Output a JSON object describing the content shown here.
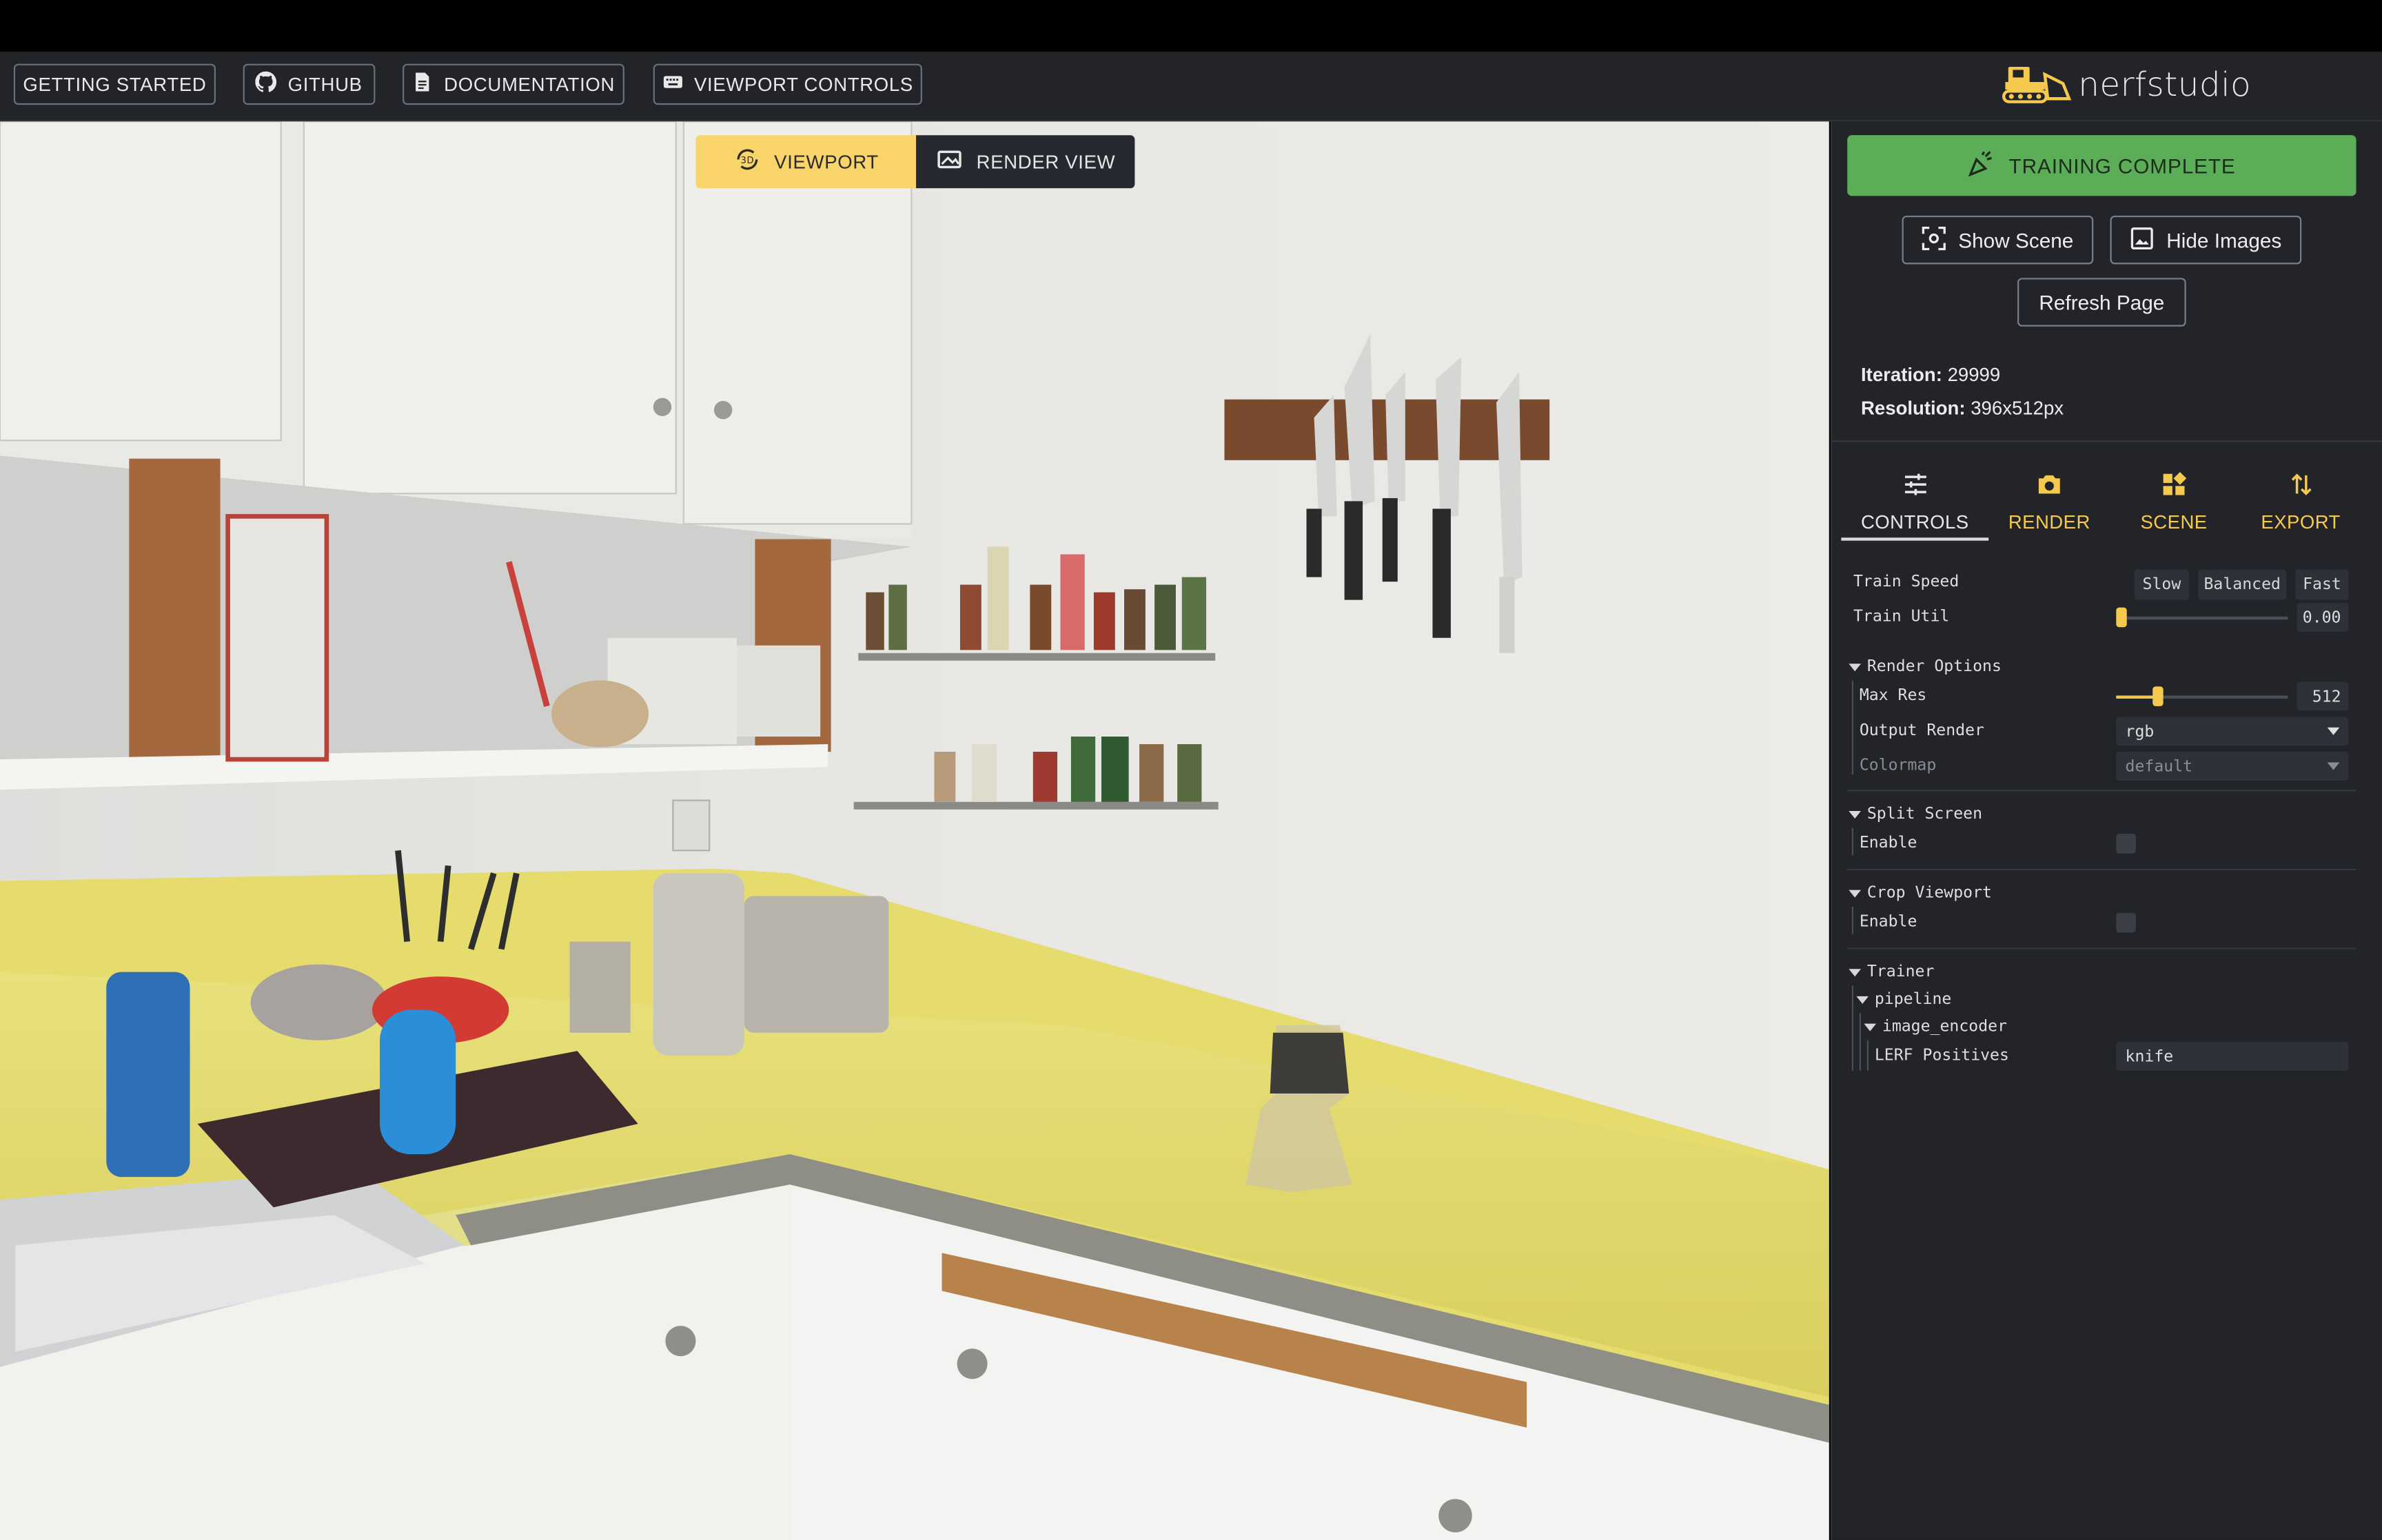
{
  "header": {
    "buttons": [
      {
        "label": "GETTING STARTED",
        "icon": ""
      },
      {
        "label": "GITHUB",
        "icon": "github-icon"
      },
      {
        "label": "DOCUMENTATION",
        "icon": "document-icon"
      },
      {
        "label": "VIEWPORT CONTROLS",
        "icon": "keyboard-icon"
      }
    ],
    "logo_text": "nerfstudio",
    "logo_icon": "bulldozer-icon"
  },
  "viewport": {
    "tabs": [
      {
        "label": "VIEWPORT",
        "icon": "3d-rotate-icon",
        "active": true
      },
      {
        "label": "RENDER VIEW",
        "icon": "camera-view-icon",
        "active": false
      }
    ],
    "scene": "kitchen-render"
  },
  "sidebar": {
    "status_button": "TRAINING COMPLETE",
    "show_scene": "Show Scene",
    "hide_images": "Hide Images",
    "refresh_page": "Refresh Page",
    "iteration_label": "Iteration:",
    "iteration_value": "29999",
    "resolution_label": "Resolution:",
    "resolution_value": "396x512px",
    "tabs": [
      {
        "label": "CONTROLS",
        "icon": "sliders-icon"
      },
      {
        "label": "RENDER",
        "icon": "camera-icon"
      },
      {
        "label": "SCENE",
        "icon": "dashboard-icon"
      },
      {
        "label": "EXPORT",
        "icon": "import-export-icon"
      }
    ],
    "controls": {
      "train_speed_label": "Train Speed",
      "speed_options": [
        "Slow",
        "Balanced",
        "Fast"
      ],
      "train_util_label": "Train Util",
      "train_util_value": "0.00",
      "train_util_fraction": 0.0,
      "render_options_label": "Render Options",
      "max_res_label": "Max Res",
      "max_res_value": "512",
      "max_res_fraction": 0.24,
      "output_render_label": "Output Render",
      "output_render_value": "rgb",
      "colormap_label": "Colormap",
      "colormap_value": "default",
      "split_screen_label": "Split Screen",
      "split_enable_label": "Enable",
      "crop_viewport_label": "Crop Viewport",
      "crop_enable_label": "Enable",
      "trainer_label": "Trainer",
      "pipeline_label": "pipeline",
      "image_encoder_label": "image_encoder",
      "lerf_label": "LERF Positives",
      "lerf_value": "knife"
    },
    "colors": {
      "accent": "#f5c94d",
      "success": "#5cad57",
      "panel": "#222429"
    }
  }
}
